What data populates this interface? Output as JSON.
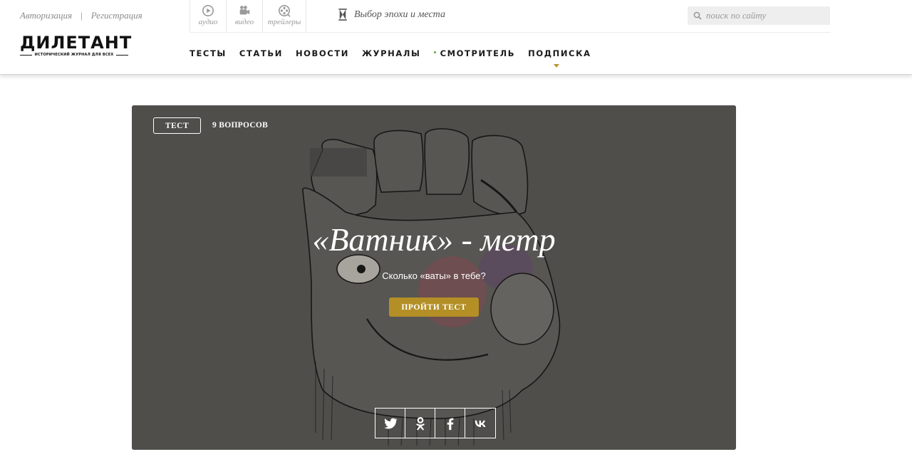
{
  "auth": {
    "login": "Авторизация",
    "separator": "|",
    "register": "Регистрация"
  },
  "logo": {
    "title": "ДИЛЕТАНТ",
    "tagline": "ИСТОРИЧЕСКИЙ ЖУРНАЛ ДЛЯ ВСЕХ"
  },
  "media": {
    "audio": "аудио",
    "video": "видео",
    "trailers": "трейлеры"
  },
  "epoch": {
    "label": "Выбор эпохи и места"
  },
  "search": {
    "placeholder": "поиск по сайту"
  },
  "nav": {
    "tests": "ТЕСТЫ",
    "articles": "СТАТЬИ",
    "news": "НОВОСТИ",
    "journals": "ЖУРНАЛЫ",
    "watcher": "СМОТРИТЕЛЬ",
    "subscription": "ПОДПИСКА"
  },
  "hero": {
    "tag": "ТЕСТ",
    "questions": "9 ВОПРОСОВ",
    "title": "«Ватник» - метр",
    "subtitle": "Сколько «ваты» в тебе?",
    "button": "ПРОЙТИ ТЕСТ"
  },
  "share": [
    "twitter-icon",
    "odnoklassniki-icon",
    "facebook-icon",
    "vk-icon"
  ],
  "colors": {
    "accent": "#b38f26",
    "nav_dot": "#5da83f",
    "hero_bg": "#5d5b58"
  }
}
